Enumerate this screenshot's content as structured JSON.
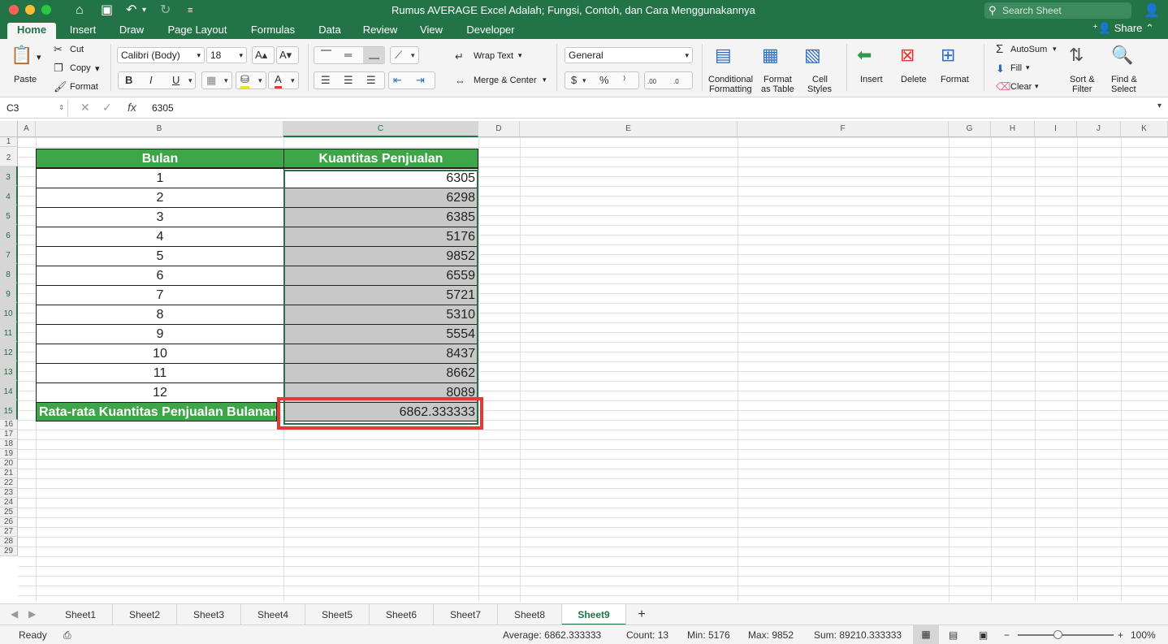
{
  "window": {
    "title": "Rumus AVERAGE Excel Adalah; Fungsi, Contoh, dan Cara Menggunakannya",
    "search_placeholder": "Search Sheet"
  },
  "ribbon_tabs": [
    "Home",
    "Insert",
    "Draw",
    "Page Layout",
    "Formulas",
    "Data",
    "Review",
    "View",
    "Developer"
  ],
  "active_tab": "Home",
  "share_label": "Share",
  "clipboard": {
    "paste": "Paste",
    "cut": "Cut",
    "copy": "Copy",
    "format": "Format"
  },
  "font": {
    "name": "Calibri (Body)",
    "size": "18",
    "bold": "B",
    "italic": "I",
    "underline": "U"
  },
  "alignment": {
    "wrap_text": "Wrap Text",
    "merge_center": "Merge & Center"
  },
  "number": {
    "format": "General",
    "currency": "$",
    "percent": "%",
    "comma": "⁾",
    "inc_decimal": ".00",
    "dec_decimal": ".0"
  },
  "styles": {
    "conditional": [
      "Conditional",
      "Formatting"
    ],
    "format_table": [
      "Format",
      "as Table"
    ],
    "cell_styles": [
      "Cell",
      "Styles"
    ]
  },
  "cells_group": {
    "insert": "Insert",
    "delete": "Delete",
    "format": "Format"
  },
  "editing": {
    "autosum": "AutoSum",
    "fill": "Fill",
    "clear": "Clear",
    "sort": [
      "Sort &",
      "Filter"
    ],
    "find": [
      "Find &",
      "Select"
    ]
  },
  "formula_bar": {
    "name_box": "C3",
    "fx": "fx",
    "value": "6305"
  },
  "columns": [
    "A",
    "B",
    "C",
    "D",
    "E",
    "F",
    "G",
    "H",
    "I",
    "J",
    "K"
  ],
  "rows": [
    "1",
    "2",
    "3",
    "4",
    "5",
    "6",
    "7",
    "8",
    "9",
    "10",
    "11",
    "12",
    "13",
    "14",
    "15",
    "16",
    "17",
    "18",
    "19",
    "20",
    "21",
    "22",
    "23",
    "24",
    "25",
    "26",
    "27",
    "28",
    "29"
  ],
  "table": {
    "header_b": "Bulan",
    "header_c": "Kuantitas Penjualan",
    "rows": [
      {
        "bulan": "1",
        "qty": "6305"
      },
      {
        "bulan": "2",
        "qty": "6298"
      },
      {
        "bulan": "3",
        "qty": "6385"
      },
      {
        "bulan": "4",
        "qty": "5176"
      },
      {
        "bulan": "5",
        "qty": "9852"
      },
      {
        "bulan": "6",
        "qty": "6559"
      },
      {
        "bulan": "7",
        "qty": "5721"
      },
      {
        "bulan": "8",
        "qty": "5310"
      },
      {
        "bulan": "9",
        "qty": "5554"
      },
      {
        "bulan": "10",
        "qty": "8437"
      },
      {
        "bulan": "11",
        "qty": "8662"
      },
      {
        "bulan": "12",
        "qty": "8089"
      }
    ],
    "avg_label": "Rata-rata Kuantitas Penjualan Bulanan",
    "avg_value": "6862.333333"
  },
  "sheets": [
    "Sheet1",
    "Sheet2",
    "Sheet3",
    "Sheet4",
    "Sheet5",
    "Sheet6",
    "Sheet7",
    "Sheet8",
    "Sheet9"
  ],
  "active_sheet": "Sheet9",
  "add_sheet": "+",
  "status": {
    "ready": "Ready",
    "average": "Average: 6862.333333",
    "count": "Count: 13",
    "min": "Min: 5176",
    "max": "Max: 9852",
    "sum": "Sum: 89210.333333",
    "zoom": "100%"
  },
  "colors": {
    "excel_green": "#227447",
    "header_green": "#3ea548",
    "highlight_red": "#e53935",
    "selected_gray": "#c8c8c8"
  }
}
